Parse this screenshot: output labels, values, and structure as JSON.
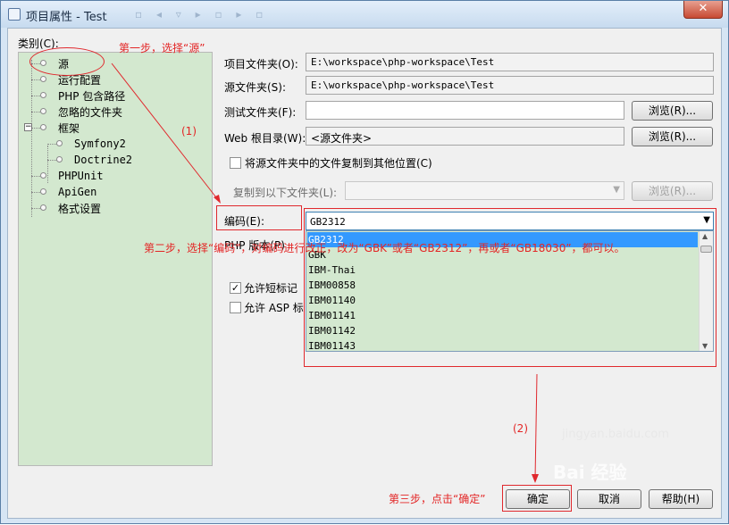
{
  "window": {
    "title": "项目属性 - Test",
    "close_glyph": "✕"
  },
  "categories": {
    "label": "类别(C):",
    "items": [
      {
        "label": "源"
      },
      {
        "label": "运行配置"
      },
      {
        "label": "PHP 包含路径"
      },
      {
        "label": "忽略的文件夹"
      },
      {
        "label": "框架",
        "expanded": true
      },
      {
        "label": "Symfony2"
      },
      {
        "label": "Doctrine2"
      },
      {
        "label": "PHPUnit"
      },
      {
        "label": "ApiGen"
      },
      {
        "label": "格式设置"
      }
    ]
  },
  "form": {
    "project_folder_label": "项目文件夹(O):",
    "project_folder_value": "E:\\workspace\\php-workspace\\Test",
    "source_folder_label": "源文件夹(S):",
    "source_folder_value": "E:\\workspace\\php-workspace\\Test",
    "test_folder_label": "测试文件夹(F):",
    "test_folder_value": "",
    "browse_label": "浏览(R)...",
    "web_root_label": "Web 根目录(W):",
    "web_root_value": "<源文件夹>",
    "copy_checkbox_label": "将源文件夹中的文件复制到其他位置(C)",
    "copy_to_label": "复制到以下文件夹(L):",
    "encoding_label": "编码(E):",
    "encoding_value": "GB2312",
    "encoding_options": [
      "GB2312",
      "GBK",
      "IBM-Thai",
      "IBM00858",
      "IBM01140",
      "IBM01141",
      "IBM01142",
      "IBM01143"
    ],
    "php_version_label": "PHP 版本(P)",
    "short_tags_label": "允许短标记",
    "short_tags_checked": true,
    "asp_tags_label": "允许 ASP 标记"
  },
  "buttons": {
    "ok": "确定",
    "cancel": "取消",
    "help": "帮助(H)"
  },
  "annotations": {
    "step1": "第一步，选择“源”",
    "step1_num": "(1)",
    "step2": "第二步，选择“编码”，对编码进行改正，改为“GBK”或者“GB2312”，再或者“GB18030”，都可以。",
    "step2_num": "(2)",
    "step3": "第三步，点击“确定”",
    "color": "#e32626"
  },
  "watermark": {
    "text": "Bai 经验",
    "sub": "jingyan.baidu.com"
  }
}
